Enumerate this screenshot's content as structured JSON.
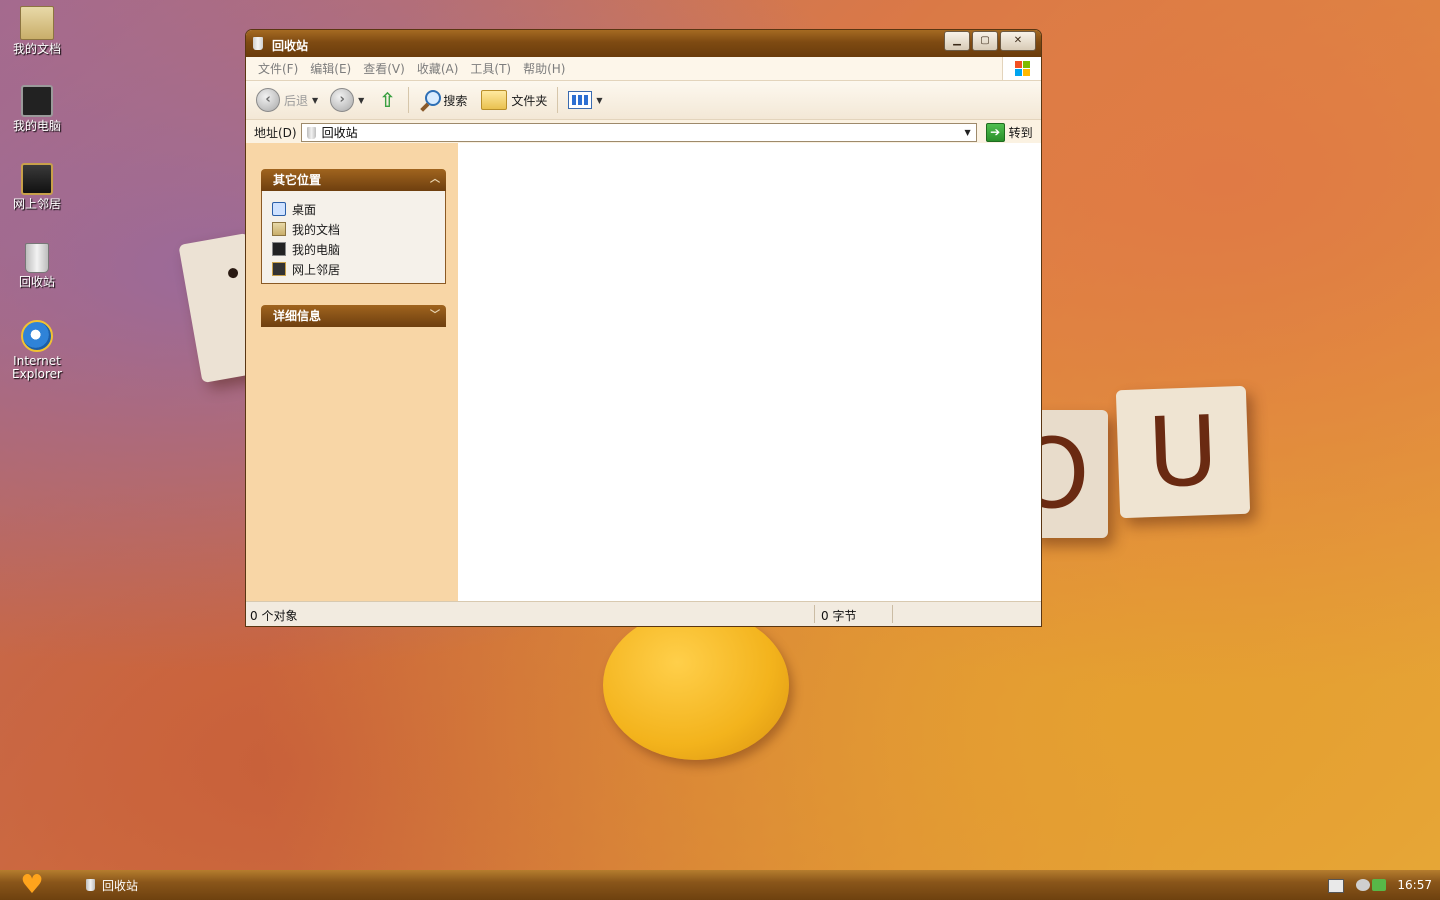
{
  "desktop": {
    "icons": [
      {
        "label": "我的文档",
        "icon": "my-documents-icon"
      },
      {
        "label": "我的电脑",
        "icon": "my-computer-icon"
      },
      {
        "label": "网上邻居",
        "icon": "network-places-icon"
      },
      {
        "label": "回收站",
        "icon": "recycle-bin-icon"
      },
      {
        "label": "Internet Explorer",
        "icon": "internet-explorer-icon"
      }
    ],
    "wallpaper_letter_u": "U",
    "wallpaper_letter_o": "O"
  },
  "window": {
    "title": "回收站",
    "menu": [
      "文件(F)",
      "编辑(E)",
      "查看(V)",
      "收藏(A)",
      "工具(T)",
      "帮助(H)"
    ],
    "toolbar": {
      "back_label": "后退",
      "search_label": "搜索",
      "folders_label": "文件夹"
    },
    "address": {
      "label": "地址(D)",
      "value": "回收站",
      "go_label": "转到"
    },
    "taskpane": {
      "other_places": {
        "title": "其它位置",
        "links": [
          "桌面",
          "我的文档",
          "我的电脑",
          "网上邻居"
        ]
      },
      "details": {
        "title": "详细信息"
      }
    },
    "status": {
      "objects": "0 个对象",
      "size": "0 字节"
    }
  },
  "taskbar": {
    "task_label": "回收站",
    "clock": "16:57"
  },
  "colors": {
    "accent": "#7e4a12",
    "taskpane_bg": "#f8d6a6",
    "start_heart": "#ffa41c"
  }
}
